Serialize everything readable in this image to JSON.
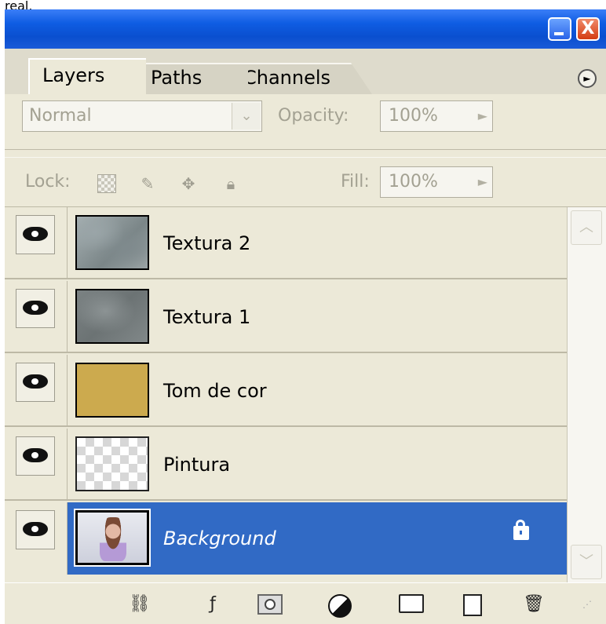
{
  "partial_top_text": "real.",
  "window": {
    "buttons": {
      "minimize": "minimize",
      "close": "X"
    }
  },
  "tabs": [
    {
      "label": "Layers",
      "active": true
    },
    {
      "label": "Paths",
      "active": false
    },
    {
      "label": "Channels",
      "active": false
    }
  ],
  "blend_mode": {
    "value": "Normal",
    "arrow": "⌄"
  },
  "opacity": {
    "label": "Opacity:",
    "value": "100%",
    "arrow": "►"
  },
  "lock": {
    "label": "Lock:"
  },
  "fill": {
    "label": "Fill:",
    "value": "100%",
    "arrow": "►"
  },
  "layers": [
    {
      "name": "Textura 2",
      "visible": true,
      "selected": false
    },
    {
      "name": "Textura 1",
      "visible": true,
      "selected": false
    },
    {
      "name": "Tom de cor",
      "visible": true,
      "selected": false,
      "thumb_color": "#ccaa4e"
    },
    {
      "name": "Pintura",
      "visible": true,
      "selected": false
    },
    {
      "name": "Background",
      "visible": true,
      "selected": true,
      "locked": true
    }
  ],
  "colors": {
    "selection": "#316ac5",
    "panel_bg": "#ece9d8",
    "titlebar": "#0a4fcf"
  },
  "scrollbar": {
    "up": "︿",
    "down": "﹀"
  },
  "bottom_icons": [
    "link-icon",
    "fx-icon",
    "mask-icon",
    "adjustment-icon",
    "folder-icon",
    "new-layer-icon",
    "trash-icon"
  ]
}
